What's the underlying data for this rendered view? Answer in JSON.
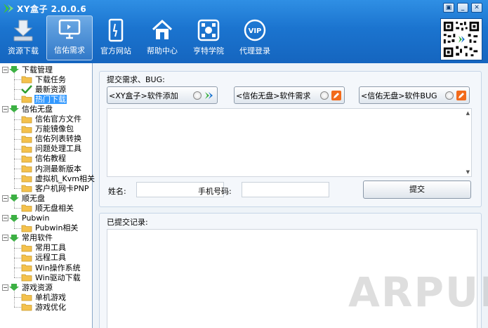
{
  "app": {
    "title": "XY盒子 2.0.0.6"
  },
  "window_buttons": [
    "▣",
    "_",
    "✕"
  ],
  "toolbar": [
    {
      "label": "资源下载",
      "icon": "download-icon",
      "active": false
    },
    {
      "label": "信佑需求",
      "icon": "monitor-icon",
      "active": true
    },
    {
      "label": "官方网站",
      "icon": "tablet-icon",
      "active": false
    },
    {
      "label": "帮助中心",
      "icon": "home-icon",
      "active": false
    },
    {
      "label": "亨特学院",
      "icon": "network-icon",
      "active": false
    },
    {
      "label": "代理登录",
      "icon": "vip-icon",
      "active": false
    }
  ],
  "tree": {
    "groups": [
      {
        "label": "下载管理",
        "children": [
          "下载任务",
          "最新资源",
          "热门下载"
        ]
      },
      {
        "label": "信佑无盘",
        "children": [
          "信佑官方文件",
          "万能镜像包",
          "信佑列表转换",
          "问题处理工具",
          "信佑教程",
          "内测最新版本",
          "虚拟机_Kvm相关",
          "客户机网卡PNP"
        ]
      },
      {
        "label": "顺无盘",
        "children": [
          "顺无盘相关"
        ]
      },
      {
        "label": "Pubwin",
        "children": [
          "Pubwin相关"
        ]
      },
      {
        "label": "常用软件",
        "children": [
          "常用工具",
          "远程工具",
          "Win操作系统",
          "Win驱动下载"
        ]
      },
      {
        "label": "游戏资源",
        "children": [
          "单机游戏",
          "游戏优化"
        ]
      }
    ],
    "selected": "热门下载",
    "checked": "最新资源"
  },
  "form": {
    "title": "提交需求、BUG:",
    "options": [
      "<XY盒子>软件添加",
      "<信佑无盘>软件需求",
      "<信佑无盘>软件BUG"
    ],
    "name_label": "姓名:",
    "phone_label": "手机号码:",
    "name_value": "",
    "phone_value": "",
    "submit_label": "提交"
  },
  "records": {
    "title": "已提交记录:"
  },
  "watermark": "ARPUN",
  "colors": {
    "titlebar": "#1b74cf",
    "selection": "#3399ff",
    "tree_arrow": "#3cb043"
  }
}
